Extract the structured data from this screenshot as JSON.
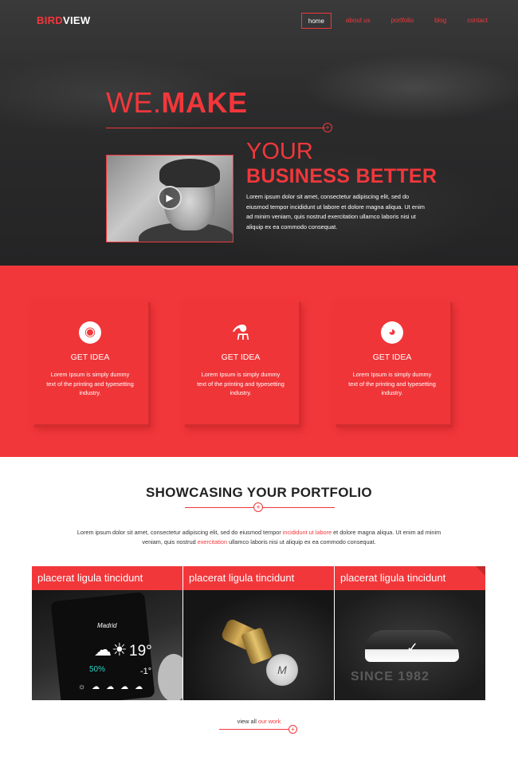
{
  "brand": {
    "part1": "BIRD",
    "part2": "VIEW"
  },
  "nav": {
    "items": [
      "home",
      "about us",
      "portfolio",
      "blog",
      "contact"
    ],
    "active": "home"
  },
  "hero": {
    "we": "WE.",
    "make": "MAKE",
    "your": "YOUR",
    "business": "BUSINESS BETTER",
    "text": "Lorem ipsum dolor sit amet, consectetur adipiscing elit, sed do eiusmod tempor incididunt ut labore et dolore magna aliqua. Ut enim ad minim veniam, quis nostrud exercitation ullamco laboris nisi ut aliquip ex ea commodo consequat.",
    "plus": "+",
    "play_icon": "▶"
  },
  "features": [
    {
      "icon": "github-icon",
      "glyph": "◉",
      "title": "GET IDEA",
      "text": "Lorem Ipsum is simply dummy text of the printing and typesetting industry."
    },
    {
      "icon": "flask-icon",
      "glyph": "⚗",
      "title": "GET IDEA",
      "text": "Lorem Ipsum is simply dummy text of the printing and typesetting industry."
    },
    {
      "icon": "globe-icon",
      "glyph": "◕",
      "title": "GET IDEA",
      "text": "Lorem Ipsum is simply dummy text of the printing and typesetting industry."
    }
  ],
  "portfolio": {
    "title": "SHOWCASING YOUR PORTFOLIO",
    "desc_a": "Lorem ipsum dolor sit amet, consectetur adipiscing elit, sed do eiusmod tempor ",
    "desc_hl1": "incididunt ut labore",
    "desc_b": " et dolore magna aliqua. Ut enim ad minim veniam, quis nostrud ",
    "desc_hl2": "exercitation",
    "desc_c": " ullamco laboris nisi ut aliquip ex ea commodo consequat.",
    "tiles": [
      {
        "title": "placerat ligula tincidunt"
      },
      {
        "title": "placerat ligula tincidunt"
      },
      {
        "title": "placerat ligula tincidunt"
      }
    ],
    "phone": {
      "city": "Madrid",
      "weather": "☁☀",
      "temp": "19°",
      "pct": "50%",
      "low": "-1°",
      "row": "☼☁☁☁☁"
    },
    "seal_text": "M",
    "shoe_text": "SINCE 1982",
    "view_all": "view all ",
    "our_work": "our work"
  },
  "colors": {
    "accent": "#f2373b",
    "dark": "#2a2a2b"
  }
}
